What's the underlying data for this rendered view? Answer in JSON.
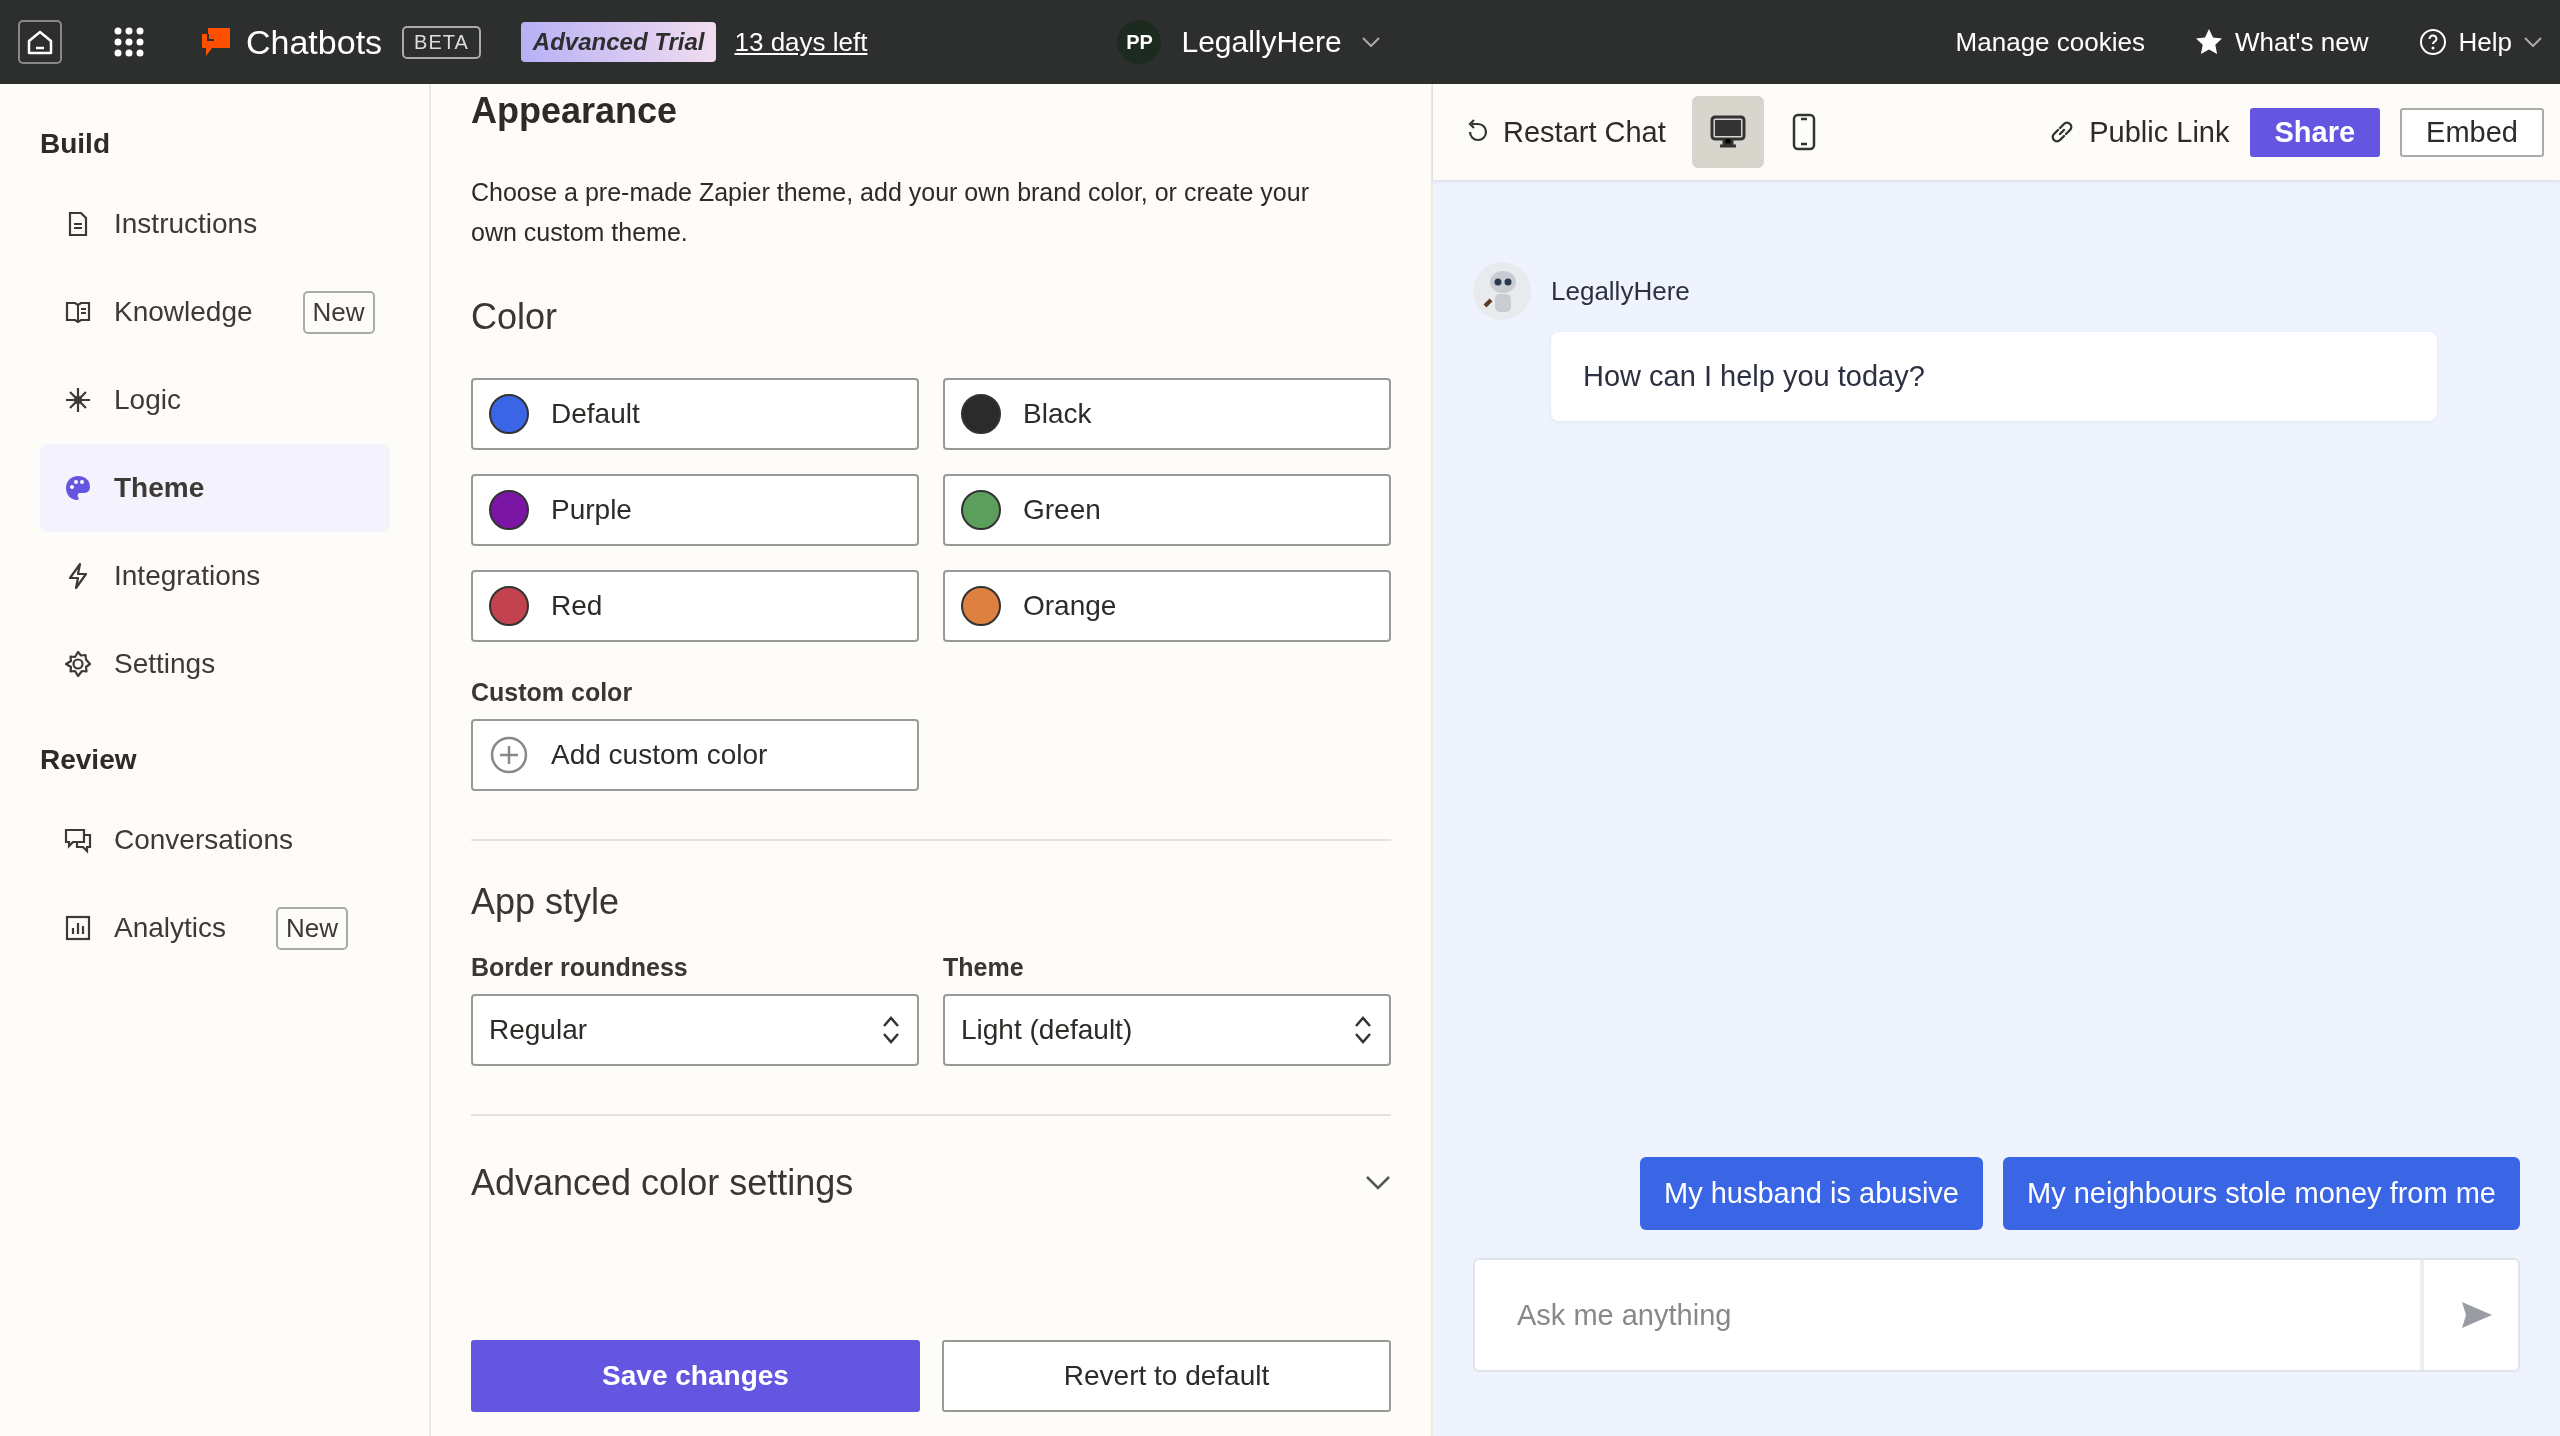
{
  "topbar": {
    "app_name": "Chatbots",
    "app_badge": "BETA",
    "plan": "Advanced Trial",
    "trial_left": "13 days left",
    "account": {
      "initials": "PP",
      "name": "LegallyHere"
    },
    "links": [
      {
        "kind": "plain",
        "label": "Manage cookies"
      },
      {
        "kind": "star",
        "label": "What's new"
      },
      {
        "kind": "help",
        "label": "Help"
      }
    ]
  },
  "sidebar": {
    "sections": [
      {
        "title": "Build",
        "items": [
          {
            "kind": "doc",
            "label": "Instructions",
            "selected": false
          },
          {
            "kind": "book",
            "label": "Knowledge",
            "badge": "New",
            "selected": false
          },
          {
            "kind": "spark",
            "label": "Logic",
            "selected": false
          },
          {
            "kind": "palette",
            "label": "Theme",
            "selected": true
          },
          {
            "kind": "bolt",
            "label": "Integrations",
            "selected": false
          },
          {
            "kind": "gear",
            "label": "Settings",
            "selected": false
          }
        ]
      },
      {
        "title": "Review",
        "items": [
          {
            "kind": "chat",
            "label": "Conversations",
            "selected": false
          },
          {
            "kind": "chart",
            "label": "Analytics",
            "badge": "New",
            "selected": false
          }
        ]
      }
    ]
  },
  "appearance": {
    "title": "Appearance",
    "description": "Choose a pre-made Zapier theme, add your own brand color, or create your own custom theme.",
    "color_heading": "Color",
    "colors": [
      {
        "label": "Default",
        "color": "#3a66e6"
      },
      {
        "label": "Black",
        "color": "#2b2b2b"
      },
      {
        "label": "Purple",
        "color": "#7a16a3"
      },
      {
        "label": "Green",
        "color": "#5c9e5c"
      },
      {
        "label": "Red",
        "color": "#c2424e"
      },
      {
        "label": "Orange",
        "color": "#de8140"
      }
    ],
    "custom_color_label": "Custom color",
    "custom_color_button": "Add custom color",
    "app_style_heading": "App style",
    "selects": [
      {
        "label": "Border roundness",
        "value": "Regular"
      },
      {
        "label": "Theme",
        "value": "Light (default)"
      }
    ],
    "advanced": {
      "label": "Advanced color settings",
      "expanded": false
    },
    "save_button": "Save changes",
    "revert_button": "Revert to default"
  },
  "preview": {
    "restart": "Restart Chat",
    "devices": [
      {
        "kind": "desktop",
        "selected": true
      },
      {
        "kind": "mobile",
        "selected": false
      }
    ],
    "public_link": "Public Link",
    "share": "Share",
    "embed": "Embed",
    "bot_name": "LegallyHere",
    "greeting": "How can I help you today?",
    "suggestions": [
      "My husband is abusive",
      "My neighbours stole money from me"
    ],
    "input": {
      "placeholder": "Ask me anything"
    }
  }
}
